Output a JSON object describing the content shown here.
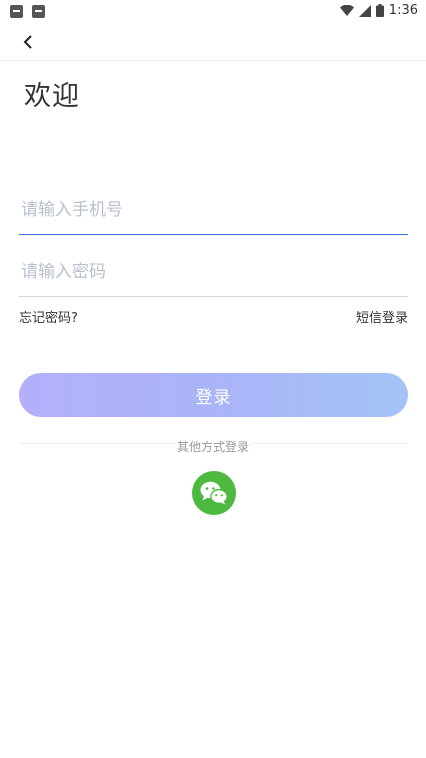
{
  "status_bar": {
    "time": "1:36",
    "icons": [
      "notification-icon",
      "notification-a-icon",
      "wifi-icon",
      "signal-icon",
      "battery-icon"
    ]
  },
  "nav": {
    "back_icon": "chevron-left-icon"
  },
  "page": {
    "title": "欢迎"
  },
  "form": {
    "phone_placeholder": "请输入手机号",
    "phone_value": "",
    "password_placeholder": "请输入密码",
    "password_value": "",
    "forgot_label": "忘记密码?",
    "sms_label": "短信登录",
    "login_label": "登录"
  },
  "other": {
    "label": "其他方式登录",
    "wechat_icon": "wechat-icon"
  },
  "colors": {
    "accent_underline": "#3b6fd9",
    "button_gradient_start": "#b3b0fa",
    "button_gradient_end": "#a3c3f5",
    "wechat_green": "#4db93e"
  }
}
